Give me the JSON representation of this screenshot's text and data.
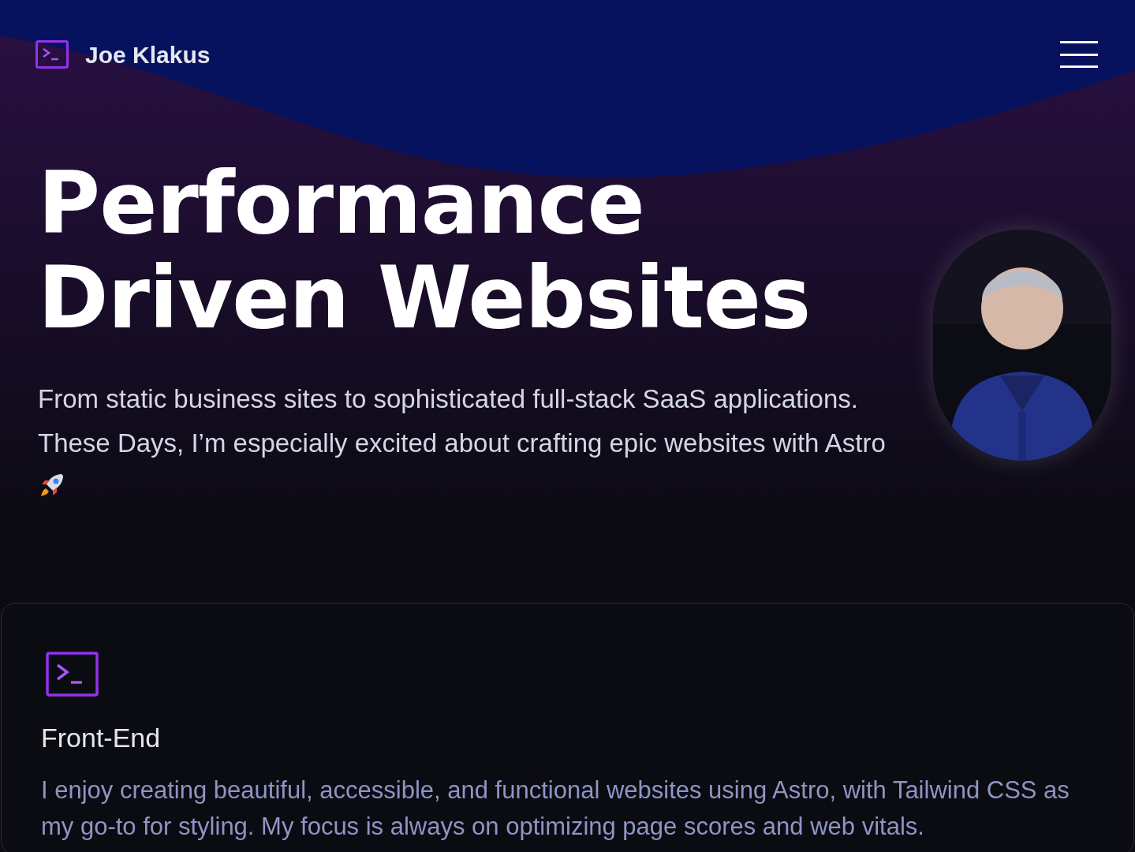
{
  "header": {
    "brand": "Joe Klakus"
  },
  "hero": {
    "title_lines": [
      "Performance",
      "Driven Websites"
    ],
    "intro": "From static business sites to sophisticated full-stack SaaS applications. These Days, I’m especially excited about crafting epic websites with Astro"
  },
  "cards": [
    {
      "title": "Front-End",
      "text": "I enjoy creating beautiful, accessible, and functional websites using Astro, with Tailwind CSS as my go-to for styling. My focus is always on optimizing page scores and web vitals."
    }
  ]
}
